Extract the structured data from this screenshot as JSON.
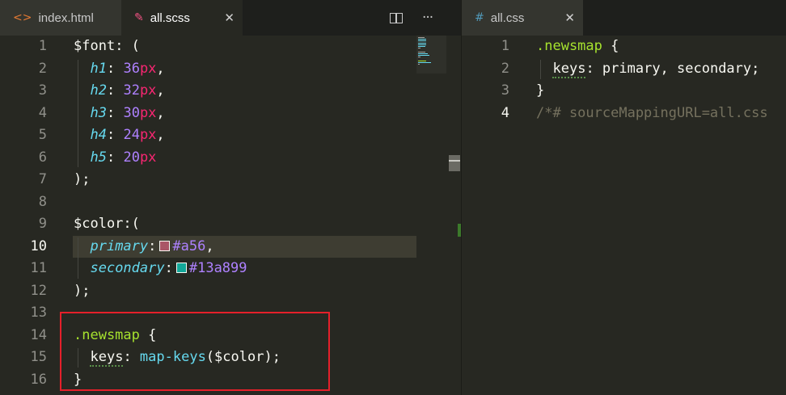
{
  "left_pane": {
    "tabs": [
      {
        "icon": "<>",
        "label": "index.html",
        "active": false
      },
      {
        "icon": "✎",
        "label": "all.scss",
        "active": true,
        "close": "✕"
      }
    ],
    "actions": {
      "split": "split-editor",
      "more": "···"
    },
    "lines": [
      {
        "n": "1",
        "tokens": [
          [
            "tok-var",
            "$font"
          ],
          [
            "tok-plain",
            ": ("
          ]
        ]
      },
      {
        "n": "2",
        "tokens": [
          [
            "tok-plain",
            "  "
          ],
          [
            "tok-prop",
            "h1"
          ],
          [
            "tok-plain",
            ": "
          ],
          [
            "tok-num",
            "36"
          ],
          [
            "tok-unit",
            "px"
          ],
          [
            "tok-plain",
            ","
          ]
        ]
      },
      {
        "n": "3",
        "tokens": [
          [
            "tok-plain",
            "  "
          ],
          [
            "tok-prop",
            "h2"
          ],
          [
            "tok-plain",
            ": "
          ],
          [
            "tok-num",
            "32"
          ],
          [
            "tok-unit",
            "px"
          ],
          [
            "tok-plain",
            ","
          ]
        ]
      },
      {
        "n": "4",
        "tokens": [
          [
            "tok-plain",
            "  "
          ],
          [
            "tok-prop",
            "h3"
          ],
          [
            "tok-plain",
            ": "
          ],
          [
            "tok-num",
            "30"
          ],
          [
            "tok-unit",
            "px"
          ],
          [
            "tok-plain",
            ","
          ]
        ]
      },
      {
        "n": "5",
        "tokens": [
          [
            "tok-plain",
            "  "
          ],
          [
            "tok-prop",
            "h4"
          ],
          [
            "tok-plain",
            ": "
          ],
          [
            "tok-num",
            "24"
          ],
          [
            "tok-unit",
            "px"
          ],
          [
            "tok-plain",
            ","
          ]
        ]
      },
      {
        "n": "6",
        "tokens": [
          [
            "tok-plain",
            "  "
          ],
          [
            "tok-prop",
            "h5"
          ],
          [
            "tok-plain",
            ": "
          ],
          [
            "tok-num",
            "20"
          ],
          [
            "tok-unit",
            "px"
          ]
        ]
      },
      {
        "n": "7",
        "tokens": [
          [
            "tok-plain",
            ");"
          ]
        ]
      },
      {
        "n": "8",
        "tokens": []
      },
      {
        "n": "9",
        "tokens": [
          [
            "tok-var",
            "$color"
          ],
          [
            "tok-plain",
            ":("
          ]
        ]
      },
      {
        "n": "10",
        "current": true,
        "tokens": [
          [
            "tok-plain",
            "  "
          ],
          [
            "tok-prop",
            "primary"
          ],
          [
            "tok-plain",
            ":"
          ],
          [
            "swatch",
            "#aa5566"
          ],
          [
            "tok-num",
            "#a56"
          ],
          [
            "tok-plain",
            ","
          ]
        ]
      },
      {
        "n": "11",
        "tokens": [
          [
            "tok-plain",
            "  "
          ],
          [
            "tok-prop",
            "secondary"
          ],
          [
            "tok-plain",
            ":"
          ],
          [
            "swatch",
            "#13a899"
          ],
          [
            "tok-num",
            "#13a899"
          ]
        ]
      },
      {
        "n": "12",
        "tokens": [
          [
            "tok-plain",
            ");"
          ]
        ]
      },
      {
        "n": "13",
        "tokens": []
      },
      {
        "n": "14",
        "tokens": [
          [
            "tok-sel",
            ".newsmap"
          ],
          [
            "tok-plain",
            " {"
          ]
        ]
      },
      {
        "n": "15",
        "tokens": [
          [
            "tok-plain",
            "  "
          ],
          [
            "tok-plain-sq",
            "keys"
          ],
          [
            "tok-plain",
            ": "
          ],
          [
            "tok-fn",
            "map-keys"
          ],
          [
            "tok-plain",
            "($color);"
          ]
        ]
      },
      {
        "n": "16",
        "tokens": [
          [
            "tok-plain",
            "}"
          ]
        ]
      }
    ]
  },
  "right_pane": {
    "tabs": [
      {
        "icon": "#",
        "label": "all.css",
        "active": true,
        "close": "✕"
      }
    ],
    "lines": [
      {
        "n": "1",
        "tokens": [
          [
            "tok-sel",
            ".newsmap"
          ],
          [
            "tok-plain",
            " {"
          ]
        ]
      },
      {
        "n": "2",
        "tokens": [
          [
            "tok-plain",
            "  "
          ],
          [
            "tok-plain-sq",
            "keys"
          ],
          [
            "tok-plain",
            ": primary, secondary;"
          ]
        ]
      },
      {
        "n": "3",
        "tokens": [
          [
            "tok-plain",
            "}"
          ]
        ]
      },
      {
        "n": "4",
        "current": true,
        "tokens": [
          [
            "tok-comment",
            "/*# sourceMappingURL=all.css"
          ]
        ]
      }
    ]
  },
  "colors": {
    "background": "#272822",
    "highlight_box": "#e5202a"
  }
}
